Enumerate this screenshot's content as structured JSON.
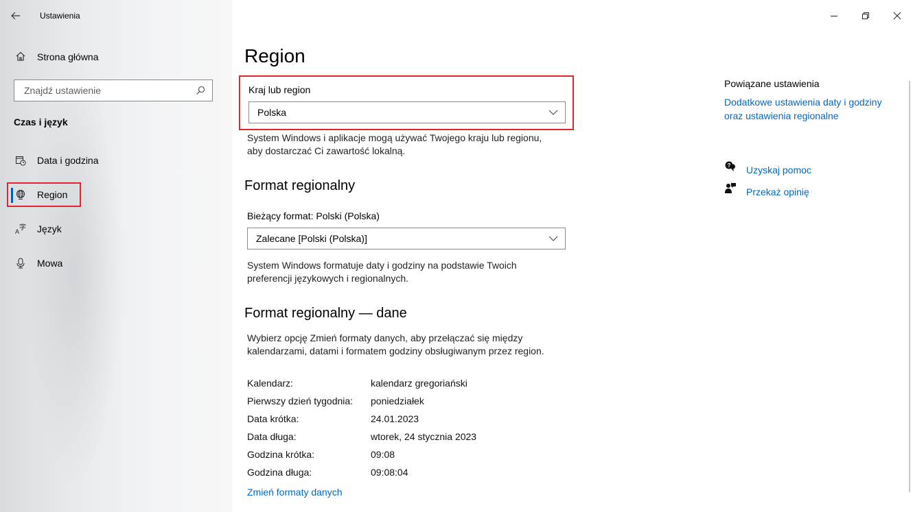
{
  "window": {
    "app_title": "Ustawienia",
    "controls": {
      "minimize": "—",
      "restore": "❐",
      "close": "✕"
    }
  },
  "sidebar": {
    "home_label": "Strona główna",
    "search_placeholder": "Znajdź ustawienie",
    "section": "Czas i język",
    "items": [
      {
        "label": "Data i godzina",
        "icon": "calendar-clock-icon",
        "active": false
      },
      {
        "label": "Region",
        "icon": "globe-icon",
        "active": true
      },
      {
        "label": "Język",
        "icon": "language-icon",
        "active": false
      },
      {
        "label": "Mowa",
        "icon": "microphone-icon",
        "active": false
      }
    ]
  },
  "main": {
    "title": "Region",
    "country": {
      "label": "Kraj lub region",
      "value": "Polska",
      "description_1": "System Windows i aplikacje mogą używać Twojego kraju lub regionu,",
      "description_2": "aby dostarczać Ci zawartość lokalną."
    },
    "regional_format": {
      "title": "Format regionalny",
      "current_label": "Bieżący format: Polski (Polska)",
      "value": "Zalecane [Polski (Polska)]",
      "description_1": "System Windows formatuje daty i godziny na podstawie Twoich",
      "description_2": "preferencji językowych i regionalnych."
    },
    "format_data": {
      "title": "Format regionalny — dane",
      "description_1": "Wybierz opcję Zmień formaty danych, aby przełączać się między",
      "description_2": "kalendarzami, datami i formatem godziny obsługiwanym przez region.",
      "rows": [
        {
          "key": "Kalendarz:",
          "value": "kalendarz gregoriański"
        },
        {
          "key": "Pierwszy dzień tygodnia:",
          "value": "poniedziałek"
        },
        {
          "key": "Data krótka:",
          "value": "24.01.2023"
        },
        {
          "key": "Data długa:",
          "value": "wtorek, 24 stycznia 2023"
        },
        {
          "key": "Godzina krótka:",
          "value": "09:08"
        },
        {
          "key": "Godzina długa:",
          "value": "09:08:04"
        }
      ],
      "change_link": "Zmień formaty danych"
    }
  },
  "related": {
    "heading": "Powiązane ustawienia",
    "link_1": "Dodatkowe ustawienia daty i godziny",
    "link_2": "oraz ustawienia regionalne",
    "help": "Uzyskaj pomoc",
    "feedback": "Przekaż opinię"
  },
  "colors": {
    "accent": "#0067c0",
    "highlight": "#e0262c"
  }
}
